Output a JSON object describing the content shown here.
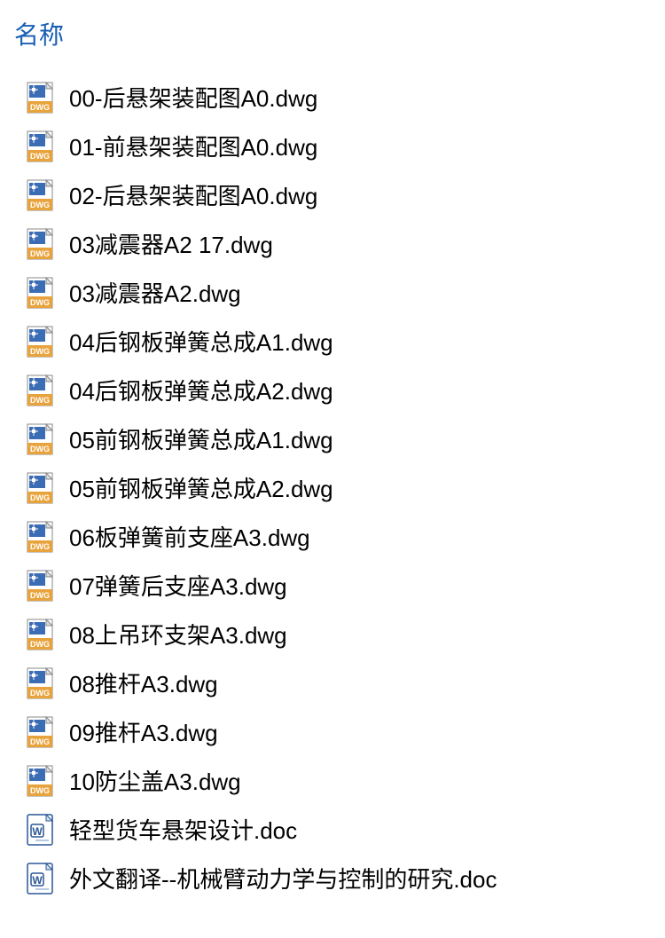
{
  "header": {
    "name_column": "名称"
  },
  "files": [
    {
      "type": "dwg",
      "name": "00-后悬架装配图A0.dwg"
    },
    {
      "type": "dwg",
      "name": "01-前悬架装配图A0.dwg"
    },
    {
      "type": "dwg",
      "name": "02-后悬架装配图A0.dwg"
    },
    {
      "type": "dwg",
      "name": "03减震器A2 17.dwg"
    },
    {
      "type": "dwg",
      "name": "03减震器A2.dwg"
    },
    {
      "type": "dwg",
      "name": "04后钢板弹簧总成A1.dwg"
    },
    {
      "type": "dwg",
      "name": "04后钢板弹簧总成A2.dwg"
    },
    {
      "type": "dwg",
      "name": "05前钢板弹簧总成A1.dwg"
    },
    {
      "type": "dwg",
      "name": "05前钢板弹簧总成A2.dwg"
    },
    {
      "type": "dwg",
      "name": "06板弹簧前支座A3.dwg"
    },
    {
      "type": "dwg",
      "name": "07弹簧后支座A3.dwg"
    },
    {
      "type": "dwg",
      "name": "08上吊环支架A3.dwg"
    },
    {
      "type": "dwg",
      "name": "08推杆A3.dwg"
    },
    {
      "type": "dwg",
      "name": "09推杆A3.dwg"
    },
    {
      "type": "dwg",
      "name": "10防尘盖A3.dwg"
    },
    {
      "type": "doc",
      "name": "轻型货车悬架设计.doc"
    },
    {
      "type": "doc",
      "name": "外文翻译--机械臂动力学与控制的研究.doc"
    }
  ]
}
